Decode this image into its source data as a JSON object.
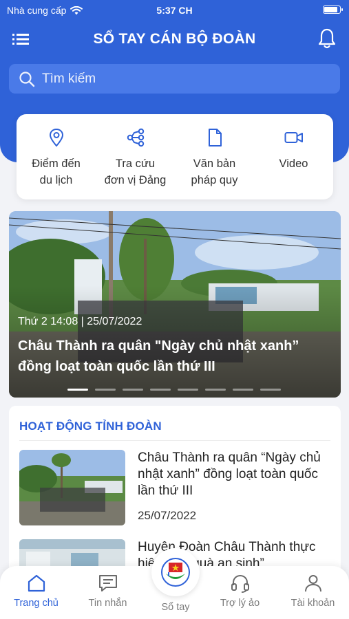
{
  "status_bar": {
    "carrier": "Nhà cung cấp",
    "time": "5:37 CH",
    "battery_level": 0.9
  },
  "header": {
    "title": "SỔ TAY CÁN BỘ ĐOÀN"
  },
  "search": {
    "placeholder": "Tìm kiếm"
  },
  "quick_actions": [
    {
      "label": "Điểm đến\ndu lịch",
      "icon": "map-pin-icon"
    },
    {
      "label": "Tra cứu\nđơn vị Đảng",
      "icon": "share-nodes-icon"
    },
    {
      "label": "Văn bản\npháp quy",
      "icon": "document-icon"
    },
    {
      "label": "Video",
      "icon": "video-camera-icon"
    }
  ],
  "banner": {
    "date": "Thứ 2 14:08 | 25/07/2022",
    "headline": "Châu Thành ra quân \"Ngày chủ nhật xanh” đồng loạt toàn quốc lần thứ III",
    "slide_count": 8,
    "active_slide": 1
  },
  "section": {
    "title": "HOẠT ĐỘNG TỈNH ĐOÀN",
    "items": [
      {
        "title": "Châu Thành ra quân “Ngày chủ nhật xanh” đồng loạt toàn quốc lần thứ III",
        "date": "25/07/2022"
      },
      {
        "title": "Huyện Đoàn Châu Thành thực hiện “Túi quà an sinh”",
        "date": ""
      }
    ]
  },
  "tabbar": {
    "items": [
      {
        "label": "Trang chủ",
        "icon": "home-icon",
        "active": true
      },
      {
        "label": "Tin nhắn",
        "icon": "message-icon",
        "active": false
      },
      {
        "label": "Sổ tay",
        "icon": "youth-union-logo",
        "active": false
      },
      {
        "label": "Trợ lý ảo",
        "icon": "headset-icon",
        "active": false
      },
      {
        "label": "Tài khoản",
        "icon": "user-icon",
        "active": false
      }
    ]
  },
  "colors": {
    "primary": "#2f62d8",
    "search_bg": "#4a7ae8",
    "background": "#f2f3f7"
  }
}
